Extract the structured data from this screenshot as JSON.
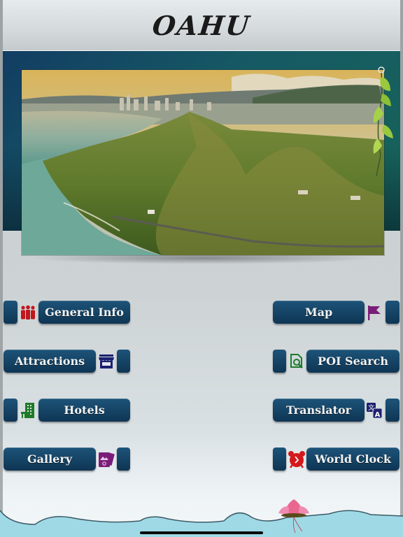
{
  "header": {
    "title": "OAHU"
  },
  "banner": {
    "image_alt": "Aerial view of Diamond Head crater and Waikiki, Oahu"
  },
  "menu": {
    "left": [
      {
        "label": "General Info",
        "icon": "people-group-icon",
        "icon_color": "#c0161c"
      },
      {
        "label": "Attractions",
        "icon": "storefront-icon",
        "icon_color": "#1c2070"
      },
      {
        "label": "Hotels",
        "icon": "hotel-building-icon",
        "icon_color": "#1f7a2a"
      },
      {
        "label": "Gallery",
        "icon": "photo-gallery-icon",
        "icon_color": "#7b1d78"
      }
    ],
    "right": [
      {
        "label": "Map",
        "icon": "flag-icon",
        "icon_color": "#7b1d78"
      },
      {
        "label": "POI Search",
        "icon": "document-search-icon",
        "icon_color": "#1f7a2a"
      },
      {
        "label": "Translator",
        "icon": "translate-icon",
        "icon_color": "#1c2070"
      },
      {
        "label": "World Clock",
        "icon": "alarm-clock-icon",
        "icon_color": "#d4171b"
      }
    ]
  },
  "colors": {
    "button": "#164668",
    "banner_dark": "#123d63",
    "banner_teal": "#176458"
  }
}
